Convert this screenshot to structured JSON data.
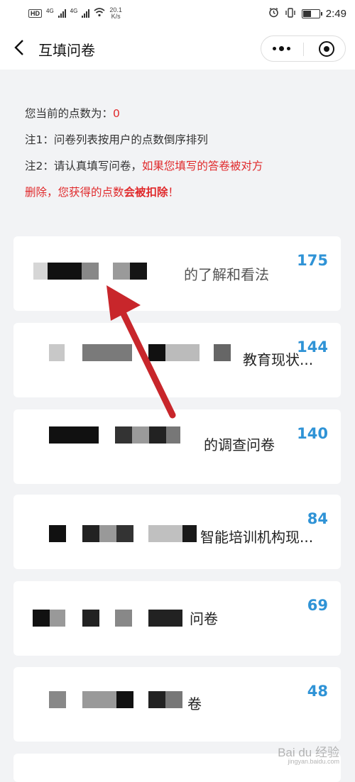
{
  "status_bar": {
    "hd": "HD",
    "net1": "4G",
    "net2": "4G",
    "speed_value": "20.1",
    "speed_unit": "K/s",
    "time": "2:49",
    "battery_level": 0.45
  },
  "header": {
    "title": "互填问卷"
  },
  "info": {
    "points_label": "您当前的点数为：",
    "points_value": "0",
    "note1": "注1：问卷列表按用户的点数倒序排列",
    "note2_prefix": "注2：请认真填写问卷，",
    "note2_red": "如果您填写的答卷被对方",
    "note2_line2_a": "删除，您获得的点数",
    "note2_line2_b": "会被扣除",
    "note2_line2_c": "！"
  },
  "surveys": [
    {
      "title": "的了解和看法",
      "score": "175"
    },
    {
      "title": "教育现状...",
      "score": "144"
    },
    {
      "title": "的调查问卷",
      "score": "140"
    },
    {
      "title": "智能培训机构现...",
      "score": "84"
    },
    {
      "title": "问卷",
      "score": "69"
    },
    {
      "title": "卷",
      "score": "48"
    }
  ],
  "colors": {
    "accent_blue": "#2f93d6",
    "warning_red": "#e0292b",
    "arrow_red": "#c8262b"
  },
  "watermark": {
    "main": "Bai du 经验",
    "sub": "jingyan.baidu.com"
  }
}
